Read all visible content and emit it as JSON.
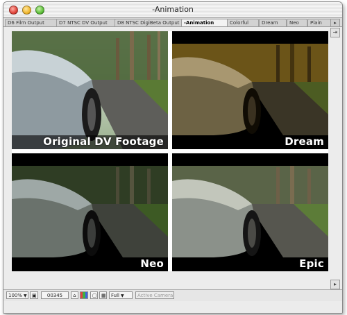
{
  "window": {
    "title": "-Animation"
  },
  "tabs": [
    {
      "label": "D6 Film Output",
      "active": false
    },
    {
      "label": "D7 NTSC DV Output",
      "active": false
    },
    {
      "label": "D8 NTSC DigiBeta Output",
      "active": false
    },
    {
      "label": "-Animation",
      "active": true
    },
    {
      "label": "Colorful",
      "active": false
    },
    {
      "label": "Dream",
      "active": false
    },
    {
      "label": "Neo",
      "active": false
    },
    {
      "label": "Plain",
      "active": false
    }
  ],
  "panels": [
    {
      "caption": "Original DV Footage",
      "look": "original"
    },
    {
      "caption": "Dream",
      "look": "dream"
    },
    {
      "caption": "Neo",
      "look": "neo"
    },
    {
      "caption": "Epic",
      "look": "epic"
    }
  ],
  "toolbar": {
    "zoom": "100%",
    "timecode": "00345",
    "resolution": "Full",
    "camera": "Active Camera"
  },
  "icons": {
    "tab_scroll": "chevron-right-icon",
    "rail_top": "arrow-right-icon",
    "rail_next": "arrow-right-icon"
  },
  "colors": {
    "window_bg": "#ececec",
    "active_tab": "#f3f3f3"
  }
}
